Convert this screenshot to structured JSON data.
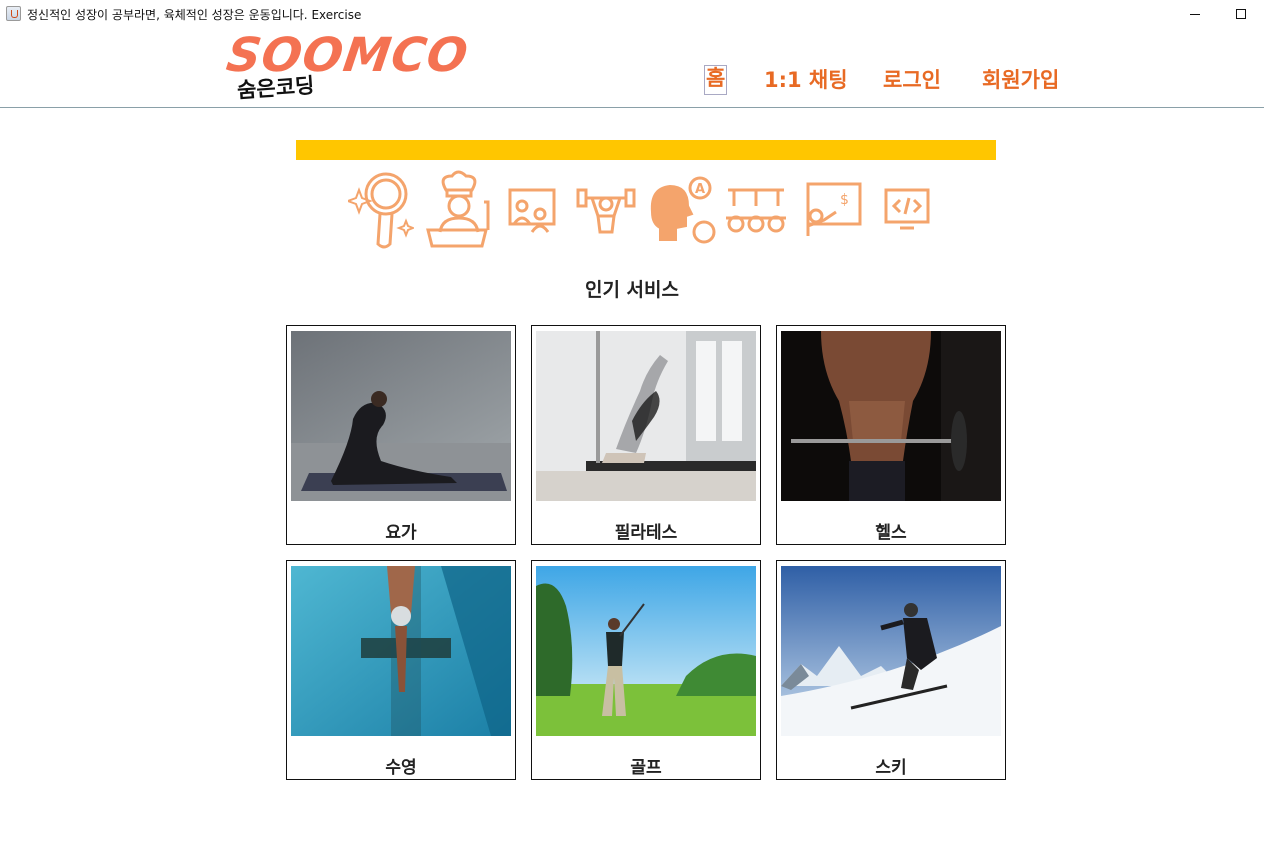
{
  "window": {
    "title": "정신적인 성장이 공부라면, 육체적인 성장은 운동입니다. Exercise"
  },
  "logo": {
    "wordmark": "SOOMCO",
    "subtitle": "숨은코딩"
  },
  "nav": {
    "home": "홈",
    "chat": "1:1 채팅",
    "login": "로그인",
    "signup": "회원가입"
  },
  "colors": {
    "accent": "#e86a24",
    "logo": "#f47252",
    "banner": "#ffc600",
    "icon": "#f4a46c"
  },
  "categories": [
    {
      "icon": "makeup-mirror-icon"
    },
    {
      "icon": "chef-cooking-icon"
    },
    {
      "icon": "online-class-icon"
    },
    {
      "icon": "fitness-weightlifting-icon"
    },
    {
      "icon": "language-learning-icon"
    },
    {
      "icon": "group-meeting-icon"
    },
    {
      "icon": "teaching-board-icon"
    },
    {
      "icon": "coding-monitor-icon"
    }
  ],
  "section": {
    "title": "인기 서비스"
  },
  "services": [
    {
      "label": "요가",
      "image": "yoga-photo"
    },
    {
      "label": "필라테스",
      "image": "pilates-photo"
    },
    {
      "label": "헬스",
      "image": "fitness-photo"
    },
    {
      "label": "수영",
      "image": "swimming-photo"
    },
    {
      "label": "골프",
      "image": "golf-photo"
    },
    {
      "label": "스키",
      "image": "ski-photo"
    }
  ]
}
